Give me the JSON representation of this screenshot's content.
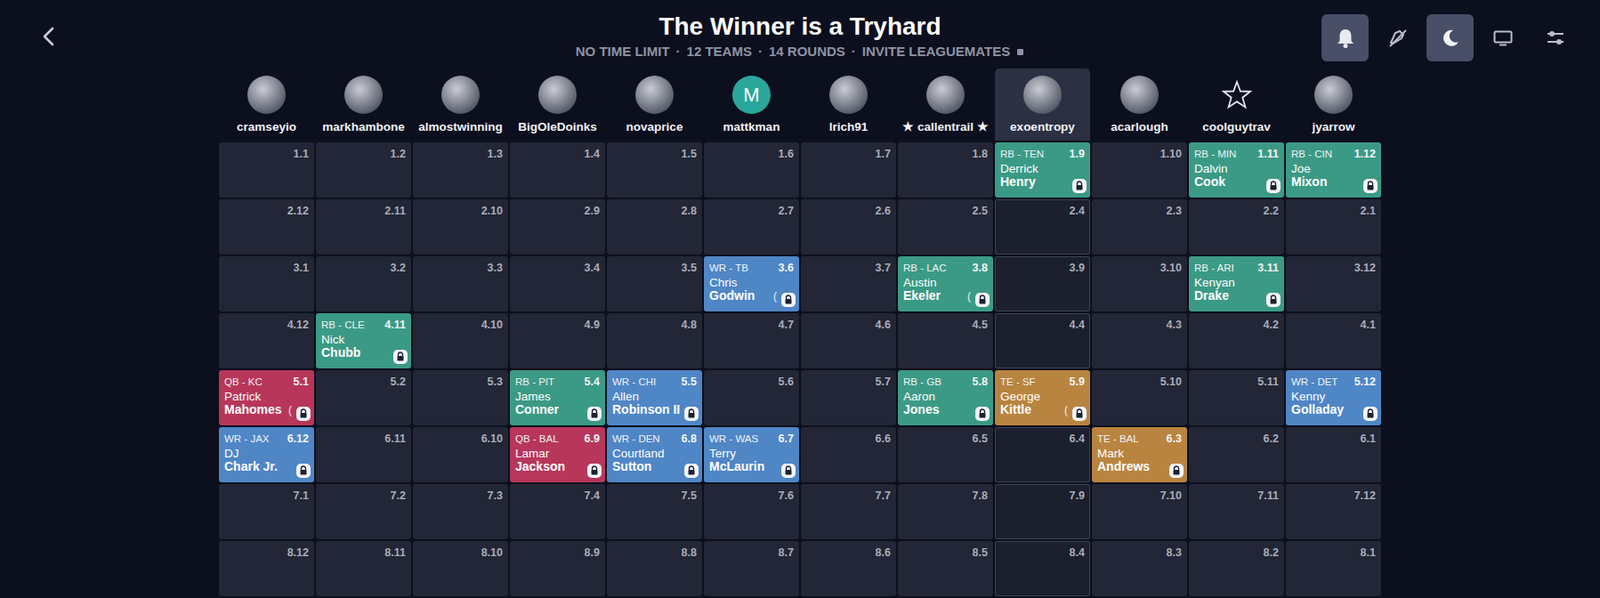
{
  "title": "The Winner is a Tryhard",
  "subtitle": [
    "NO TIME LIMIT",
    "12 TEAMS",
    "14 ROUNDS",
    "INVITE LEAGUEMATES"
  ],
  "separator": "·",
  "toolbar": [
    {
      "kind": "bell",
      "on": true
    },
    {
      "kind": "mute",
      "on": false
    },
    {
      "kind": "moon",
      "on": true
    },
    {
      "kind": "tv",
      "on": false
    },
    {
      "kind": "settings",
      "on": false
    }
  ],
  "teams": [
    {
      "name": "cramseyio",
      "avatar": "picture",
      "selected": false
    },
    {
      "name": "markhambone",
      "avatar": "picture",
      "selected": false
    },
    {
      "name": "almostwinning",
      "avatar": "picture",
      "selected": false
    },
    {
      "name": "BigOleDoinks",
      "avatar": "picture",
      "selected": false
    },
    {
      "name": "novaprice",
      "avatar": "picture",
      "selected": false
    },
    {
      "name": "mattkman",
      "avatar": "letter",
      "letter": "M",
      "selected": false
    },
    {
      "name": "lrich91",
      "avatar": "picture",
      "selected": false
    },
    {
      "name": "★ callentrail ★",
      "avatar": "picture",
      "selected": false
    },
    {
      "name": "exoentropy",
      "avatar": "picture",
      "selected": true
    },
    {
      "name": "acarlough",
      "avatar": "picture",
      "selected": false
    },
    {
      "name": "coolguytrav",
      "avatar": "star",
      "selected": false
    },
    {
      "name": "jyarrow",
      "avatar": "picture",
      "selected": false
    }
  ],
  "rows": [
    [
      {
        "pick": "1.1"
      },
      {
        "pick": "1.2"
      },
      {
        "pick": "1.3"
      },
      {
        "pick": "1.4"
      },
      {
        "pick": "1.5"
      },
      {
        "pick": "1.6"
      },
      {
        "pick": "1.7"
      },
      {
        "pick": "1.8"
      },
      {
        "pick": "1.9",
        "player": {
          "position": "RB - TEN",
          "first": "Derrick",
          "last": "Henry",
          "locked": true,
          "color": "#3b9a85"
        }
      },
      {
        "pick": "1.10"
      },
      {
        "pick": "1.11",
        "player": {
          "position": "RB - MIN",
          "first": "Dalvin",
          "last": "Cook",
          "locked": true,
          "color": "#3b9a85"
        }
      },
      {
        "pick": "1.12",
        "player": {
          "position": "RB - CIN",
          "first": "Joe",
          "last": "Mixon",
          "locked": true,
          "color": "#3b9a85"
        }
      }
    ],
    [
      {
        "pick": "2.12"
      },
      {
        "pick": "2.11"
      },
      {
        "pick": "2.10"
      },
      {
        "pick": "2.9"
      },
      {
        "pick": "2.8"
      },
      {
        "pick": "2.7"
      },
      {
        "pick": "2.6"
      },
      {
        "pick": "2.5"
      },
      {
        "pick": "2.4"
      },
      {
        "pick": "2.3"
      },
      {
        "pick": "2.2"
      },
      {
        "pick": "2.1"
      }
    ],
    [
      {
        "pick": "3.1"
      },
      {
        "pick": "3.2"
      },
      {
        "pick": "3.3"
      },
      {
        "pick": "3.4"
      },
      {
        "pick": "3.5"
      },
      {
        "pick": "3.6",
        "player": {
          "position": "WR - TB",
          "first": "Chris",
          "last": "Godwin",
          "note": "(",
          "locked": true,
          "color": "#4f86c6"
        }
      },
      {
        "pick": "3.7"
      },
      {
        "pick": "3.8",
        "player": {
          "position": "RB - LAC",
          "first": "Austin",
          "last": "Ekeler",
          "note": "(",
          "locked": true,
          "color": "#3b9a85"
        }
      },
      {
        "pick": "3.9"
      },
      {
        "pick": "3.10"
      },
      {
        "pick": "3.11",
        "player": {
          "position": "RB - ARI",
          "first": "Kenyan",
          "last": "Drake",
          "locked": true,
          "color": "#3b9a85"
        }
      },
      {
        "pick": "3.12"
      }
    ],
    [
      {
        "pick": "4.12"
      },
      {
        "pick": "4.11",
        "player": {
          "position": "RB - CLE",
          "first": "Nick",
          "last": "Chubb",
          "locked": true,
          "color": "#3b9a85"
        }
      },
      {
        "pick": "4.10"
      },
      {
        "pick": "4.9"
      },
      {
        "pick": "4.8"
      },
      {
        "pick": "4.7"
      },
      {
        "pick": "4.6"
      },
      {
        "pick": "4.5"
      },
      {
        "pick": "4.4"
      },
      {
        "pick": "4.3"
      },
      {
        "pick": "4.2"
      },
      {
        "pick": "4.1"
      }
    ],
    [
      {
        "pick": "5.1",
        "player": {
          "position": "QB - KC",
          "first": "Patrick",
          "last": "Mahomes",
          "note": "(",
          "locked": true,
          "color": "#b7365a"
        }
      },
      {
        "pick": "5.2"
      },
      {
        "pick": "5.3"
      },
      {
        "pick": "5.4",
        "player": {
          "position": "RB - PIT",
          "first": "James",
          "last": "Conner",
          "locked": true,
          "color": "#3b9a85"
        }
      },
      {
        "pick": "5.5",
        "player": {
          "position": "WR - CHI",
          "first": "Allen",
          "last": "Robinson II",
          "locked": true,
          "color": "#4f86c6"
        }
      },
      {
        "pick": "5.6"
      },
      {
        "pick": "5.7"
      },
      {
        "pick": "5.8",
        "player": {
          "position": "RB - GB",
          "first": "Aaron",
          "last": "Jones",
          "locked": true,
          "color": "#3b9a85"
        }
      },
      {
        "pick": "5.9",
        "player": {
          "position": "TE - SF",
          "first": "George",
          "last": "Kittle",
          "note": "(",
          "locked": true,
          "color": "#b9843f"
        }
      },
      {
        "pick": "5.10"
      },
      {
        "pick": "5.11"
      },
      {
        "pick": "5.12",
        "player": {
          "position": "WR - DET",
          "first": "Kenny",
          "last": "Golladay",
          "locked": true,
          "color": "#4f86c6"
        }
      }
    ],
    [
      {
        "pick": "6.12",
        "player": {
          "position": "WR - JAX",
          "first": "DJ",
          "last": "Chark Jr.",
          "locked": true,
          "color": "#4f86c6"
        }
      },
      {
        "pick": "6.11"
      },
      {
        "pick": "6.10"
      },
      {
        "pick": "6.9",
        "player": {
          "position": "QB - BAL",
          "first": "Lamar",
          "last": "Jackson",
          "locked": true,
          "color": "#b7365a"
        }
      },
      {
        "pick": "6.8",
        "player": {
          "position": "WR - DEN",
          "first": "Courtland",
          "last": "Sutton",
          "locked": true,
          "color": "#4f86c6"
        }
      },
      {
        "pick": "6.7",
        "player": {
          "position": "WR - WAS",
          "first": "Terry",
          "last": "McLaurin",
          "locked": true,
          "color": "#4f86c6"
        }
      },
      {
        "pick": "6.6"
      },
      {
        "pick": "6.5"
      },
      {
        "pick": "6.4"
      },
      {
        "pick": "6.3",
        "player": {
          "position": "TE - BAL",
          "first": "Mark",
          "last": "Andrews",
          "locked": true,
          "color": "#b9843f"
        }
      },
      {
        "pick": "6.2"
      },
      {
        "pick": "6.1"
      }
    ],
    [
      {
        "pick": "7.1"
      },
      {
        "pick": "7.2"
      },
      {
        "pick": "7.3"
      },
      {
        "pick": "7.4"
      },
      {
        "pick": "7.5"
      },
      {
        "pick": "7.6"
      },
      {
        "pick": "7.7"
      },
      {
        "pick": "7.8"
      },
      {
        "pick": "7.9"
      },
      {
        "pick": "7.10"
      },
      {
        "pick": "7.11"
      },
      {
        "pick": "7.12"
      }
    ],
    [
      {
        "pick": "8.12"
      },
      {
        "pick": "8.11"
      },
      {
        "pick": "8.10"
      },
      {
        "pick": "8.9"
      },
      {
        "pick": "8.8"
      },
      {
        "pick": "8.7"
      },
      {
        "pick": "8.6"
      },
      {
        "pick": "8.5"
      },
      {
        "pick": "8.4"
      },
      {
        "pick": "8.3"
      },
      {
        "pick": "8.2"
      },
      {
        "pick": "8.1"
      }
    ]
  ]
}
